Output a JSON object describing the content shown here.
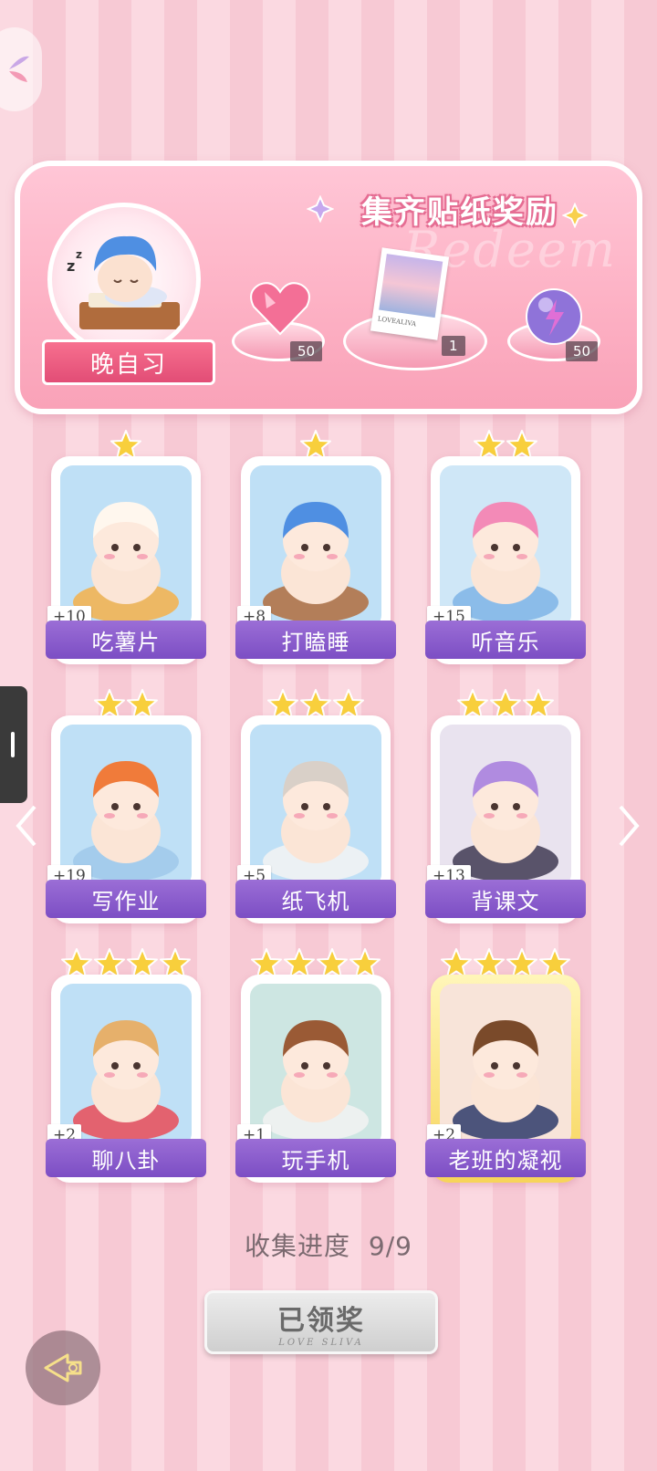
{
  "banner": {
    "title": "集齐贴纸奖励",
    "watermark": "Redeem",
    "medal_label": "晚自习",
    "rewards": [
      {
        "icon": "heart-gem-icon",
        "count": "50"
      },
      {
        "icon": "photo-card-icon",
        "count": "1",
        "caption": "LOVEALIVA"
      },
      {
        "icon": "energy-orb-icon",
        "count": "50"
      }
    ]
  },
  "stickers": [
    {
      "name": "吃薯片",
      "points": "+10",
      "stars": 1,
      "art": "cat-eating-chips"
    },
    {
      "name": "打瞌睡",
      "points": "+8",
      "stars": 1,
      "art": "boy-sleeping-desk"
    },
    {
      "name": "听音乐",
      "points": "+15",
      "stars": 2,
      "art": "girl-headphones"
    },
    {
      "name": "写作业",
      "points": "+19",
      "stars": 2,
      "art": "boy-homework"
    },
    {
      "name": "纸飞机",
      "points": "+5",
      "stars": 3,
      "art": "cat-paper-plane"
    },
    {
      "name": "背课文",
      "points": "+13",
      "stars": 3,
      "art": "girl-reciting"
    },
    {
      "name": "聊八卦",
      "points": "+2",
      "stars": 4,
      "art": "dog-watermelon"
    },
    {
      "name": "玩手机",
      "points": "+1",
      "stars": 4,
      "art": "girl-phone"
    },
    {
      "name": "老班的凝视",
      "points": "+2",
      "stars": 4,
      "art": "teacher-glasses",
      "special": true
    }
  ],
  "progress": {
    "label": "收集进度",
    "value": "9/9"
  },
  "claim_button": {
    "label": "已领奖",
    "sub": "LOVE SLIVA"
  },
  "colors": {
    "accent": "#8a5ccb",
    "banner": "#fdb2c5",
    "gold": "#f7d45a"
  }
}
